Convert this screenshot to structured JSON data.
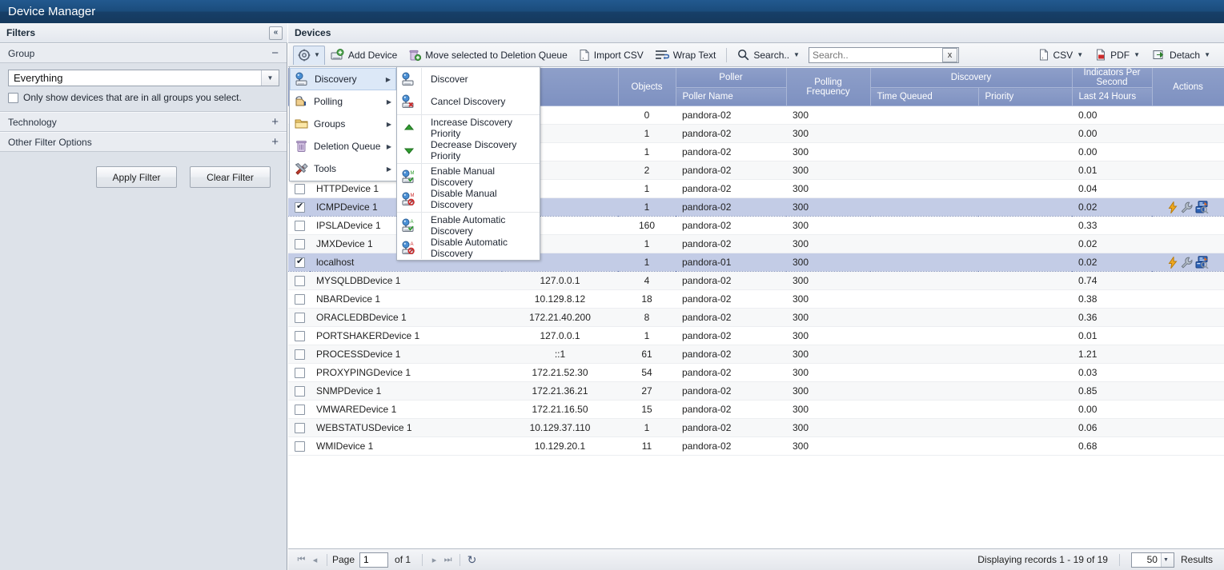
{
  "app": {
    "title": "Device Manager"
  },
  "filters": {
    "header": "Filters",
    "collapse_icon": "collapse-left-icon",
    "sections": [
      {
        "label": "Group",
        "sign": "−"
      },
      {
        "label": "Technology",
        "sign": "+"
      },
      {
        "label": "Other Filter Options",
        "sign": "+"
      }
    ],
    "group_select": {
      "value": "Everything"
    },
    "only_show_checkbox": {
      "label": "Only show devices that are in all groups you select.",
      "checked": false
    },
    "apply_label": "Apply Filter",
    "clear_label": "Clear Filter"
  },
  "devices": {
    "header": "Devices",
    "toolbar": {
      "gear_label": "gear-icon",
      "add_device": "Add Device",
      "move_to_deletion": "Move selected to Deletion Queue",
      "import_csv": "Import CSV",
      "wrap_text": "Wrap Text",
      "search_label": "Search..",
      "search_value": "",
      "search_placeholder": "Search..",
      "clear_label": "x",
      "csv": "CSV",
      "pdf": "PDF",
      "detach": "Detach"
    },
    "columns": {
      "objects": "Objects",
      "poller_group": "Poller",
      "poller_name": "Poller Name",
      "polling_frequency": "Polling Frequency",
      "discovery_group": "Discovery",
      "time_queued": "Time Queued",
      "priority": "Priority",
      "ips_group": "Indicators Per Second",
      "last_24_hours": "Last 24 Hours",
      "actions": "Actions"
    },
    "rows": [
      {
        "checked": false,
        "name": "",
        "ip": "",
        "objects": "0",
        "poller": "pandora-02",
        "freq": "300",
        "queued": "",
        "priority": "",
        "ips": "0.00",
        "actions": false
      },
      {
        "checked": false,
        "name": "",
        "ip": "",
        "objects": "1",
        "poller": "pandora-02",
        "freq": "300",
        "queued": "",
        "priority": "",
        "ips": "0.00",
        "actions": false
      },
      {
        "checked": false,
        "name": "",
        "ip": "",
        "objects": "1",
        "poller": "pandora-02",
        "freq": "300",
        "queued": "",
        "priority": "",
        "ips": "0.00",
        "actions": false
      },
      {
        "checked": false,
        "name": "",
        "ip": "",
        "objects": "2",
        "poller": "pandora-02",
        "freq": "300",
        "queued": "",
        "priority": "",
        "ips": "0.01",
        "actions": false
      },
      {
        "checked": false,
        "name": "HTTPDevice 1",
        "ip": "",
        "objects": "1",
        "poller": "pandora-02",
        "freq": "300",
        "queued": "",
        "priority": "",
        "ips": "0.04",
        "actions": false
      },
      {
        "checked": true,
        "name": "ICMPDevice 1",
        "ip": "",
        "objects": "1",
        "poller": "pandora-02",
        "freq": "300",
        "queued": "",
        "priority": "",
        "ips": "0.02",
        "actions": true
      },
      {
        "checked": false,
        "name": "IPSLADevice 1",
        "ip": "",
        "objects": "160",
        "poller": "pandora-02",
        "freq": "300",
        "queued": "",
        "priority": "",
        "ips": "0.33",
        "actions": false
      },
      {
        "checked": false,
        "name": "JMXDevice 1",
        "ip": "",
        "objects": "1",
        "poller": "pandora-02",
        "freq": "300",
        "queued": "",
        "priority": "",
        "ips": "0.02",
        "actions": false
      },
      {
        "checked": true,
        "name": "localhost",
        "ip": "",
        "objects": "1",
        "poller": "pandora-01",
        "freq": "300",
        "queued": "",
        "priority": "",
        "ips": "0.02",
        "actions": true
      },
      {
        "checked": false,
        "name": "MYSQLDBDevice 1",
        "ip": "127.0.0.1",
        "objects": "4",
        "poller": "pandora-02",
        "freq": "300",
        "queued": "",
        "priority": "",
        "ips": "0.74",
        "actions": false
      },
      {
        "checked": false,
        "name": "NBARDevice 1",
        "ip": "10.129.8.12",
        "objects": "18",
        "poller": "pandora-02",
        "freq": "300",
        "queued": "",
        "priority": "",
        "ips": "0.38",
        "actions": false
      },
      {
        "checked": false,
        "name": "ORACLEDBDevice 1",
        "ip": "172.21.40.200",
        "objects": "8",
        "poller": "pandora-02",
        "freq": "300",
        "queued": "",
        "priority": "",
        "ips": "0.36",
        "actions": false
      },
      {
        "checked": false,
        "name": "PORTSHAKERDevice 1",
        "ip": "127.0.0.1",
        "objects": "1",
        "poller": "pandora-02",
        "freq": "300",
        "queued": "",
        "priority": "",
        "ips": "0.01",
        "actions": false
      },
      {
        "checked": false,
        "name": "PROCESSDevice 1",
        "ip": "::1",
        "objects": "61",
        "poller": "pandora-02",
        "freq": "300",
        "queued": "",
        "priority": "",
        "ips": "1.21",
        "actions": false
      },
      {
        "checked": false,
        "name": "PROXYPINGDevice 1",
        "ip": "172.21.52.30",
        "objects": "54",
        "poller": "pandora-02",
        "freq": "300",
        "queued": "",
        "priority": "",
        "ips": "0.03",
        "actions": false
      },
      {
        "checked": false,
        "name": "SNMPDevice 1",
        "ip": "172.21.36.21",
        "objects": "27",
        "poller": "pandora-02",
        "freq": "300",
        "queued": "",
        "priority": "",
        "ips": "0.85",
        "actions": false
      },
      {
        "checked": false,
        "name": "VMWAREDevice 1",
        "ip": "172.21.16.50",
        "objects": "15",
        "poller": "pandora-02",
        "freq": "300",
        "queued": "",
        "priority": "",
        "ips": "0.00",
        "actions": false
      },
      {
        "checked": false,
        "name": "WEBSTATUSDevice 1",
        "ip": "10.129.37.110",
        "objects": "1",
        "poller": "pandora-02",
        "freq": "300",
        "queued": "",
        "priority": "",
        "ips": "0.06",
        "actions": false
      },
      {
        "checked": false,
        "name": "WMIDevice 1",
        "ip": "10.129.20.1",
        "objects": "11",
        "poller": "pandora-02",
        "freq": "300",
        "queued": "",
        "priority": "",
        "ips": "0.68",
        "actions": false
      }
    ]
  },
  "footer": {
    "page_label": "Page",
    "page_value": "1",
    "of_label": "of 1",
    "refresh_icon": "refresh-icon",
    "records_text": "Displaying records 1 - 19 of 19",
    "page_size": "50",
    "results_label": "Results"
  },
  "menu_level1": [
    {
      "label": "Discovery",
      "icon": "discovery-icon",
      "submenu": true,
      "active": true
    },
    {
      "label": "Polling",
      "icon": "polling-icon",
      "submenu": true,
      "active": false
    },
    {
      "label": "Groups",
      "icon": "folder-icon",
      "submenu": true,
      "active": false
    },
    {
      "label": "Deletion Queue",
      "icon": "trash-icon",
      "submenu": true,
      "active": false
    },
    {
      "label": "Tools",
      "icon": "tools-icon",
      "submenu": true,
      "active": false
    }
  ],
  "menu_level2": [
    {
      "label": "Discover",
      "icon": "discover-icon",
      "divider_after": false
    },
    {
      "label": "Cancel Discovery",
      "icon": "cancel-discovery-icon",
      "divider_after": true
    },
    {
      "label": "Increase Discovery Priority",
      "icon": "arrow-up-green-icon",
      "divider_after": false
    },
    {
      "label": "Decrease Discovery Priority",
      "icon": "arrow-down-green-icon",
      "divider_after": true
    },
    {
      "label": "Enable Manual Discovery",
      "icon": "enable-manual-discovery-icon",
      "divider_after": false
    },
    {
      "label": "Disable Manual Discovery",
      "icon": "disable-manual-discovery-icon",
      "divider_after": true
    },
    {
      "label": "Enable Automatic Discovery",
      "icon": "enable-automatic-discovery-icon",
      "divider_after": false
    },
    {
      "label": "Disable Automatic Discovery",
      "icon": "disable-automatic-discovery-icon",
      "divider_after": false
    }
  ],
  "colors": {
    "titlebar": "#1b4c7c",
    "header_row": "#7e91c1",
    "selected_row": "#c3cce6",
    "panel_bg": "#dde2e9"
  }
}
